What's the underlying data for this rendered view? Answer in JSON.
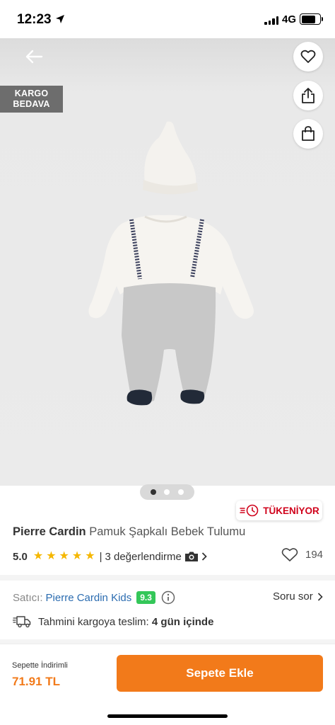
{
  "status_bar": {
    "time": "12:23",
    "network": "4G",
    "location_icon": "location-arrow-icon",
    "signal_icon": "signal-bars-icon",
    "battery_icon": "battery-icon",
    "battery_level": 0.78
  },
  "hero": {
    "back_icon": "arrow-left-icon",
    "favorite_icon": "heart-icon",
    "share_icon": "share-icon",
    "bag_icon": "shopping-bag-icon",
    "badge": {
      "line1": "KARGO",
      "line2": "BEDAVA"
    },
    "gallery_page_count": 3,
    "gallery_active_index": 0
  },
  "stock_alert": {
    "icon": "clock-speed-icon",
    "label": "TÜKENİYOR",
    "color": "#d0021b"
  },
  "product": {
    "brand": "Pierre Cardin",
    "name": "Pamuk Şapkalı Bebek Tulumu"
  },
  "rating": {
    "score": "5.0",
    "stars": 5,
    "separator": "|",
    "review_text": "3 değerlendirme",
    "camera_icon": "camera-icon",
    "chevron_icon": "chevron-right-icon",
    "favorite_count": "194",
    "favorite_icon": "heart-outline-icon"
  },
  "seller": {
    "label": "Satıcı:",
    "name": "Pierre Cardin Kids",
    "score": "9.3",
    "info_icon": "info-icon",
    "question_label": "Soru sor"
  },
  "shipping": {
    "icon": "truck-icon",
    "label": "Tahmini kargoya teslim:",
    "days": "4 gün içinde"
  },
  "bottom": {
    "price_label": "Sepette İndirimli",
    "price": "71.91 TL",
    "cart_button": "Sepete Ekle"
  },
  "colors": {
    "accent": "#f27a1a",
    "star": "#f5b700",
    "seller_link": "#2b6cb0",
    "seller_score_bg": "#34c759",
    "badge_bg": "#6d6d6d"
  }
}
